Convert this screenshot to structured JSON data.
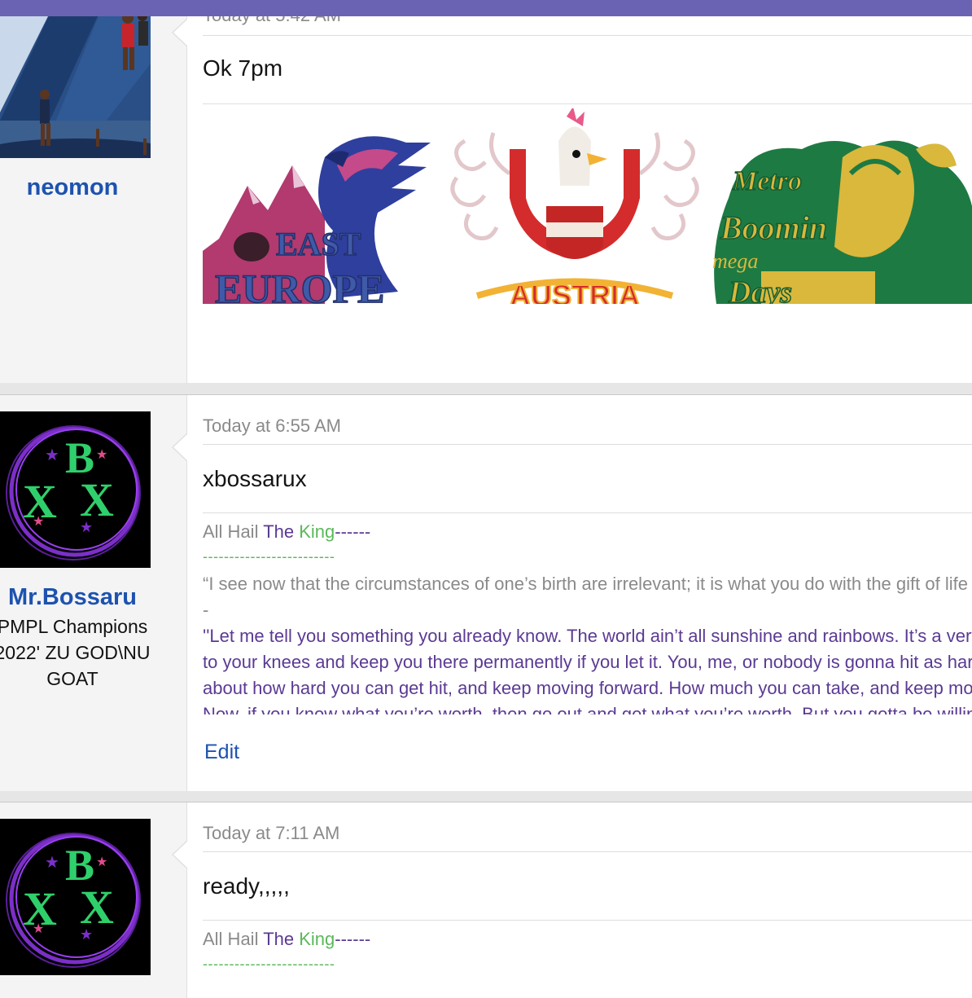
{
  "header": {
    "bar_color": "#6a63b4"
  },
  "posts": [
    {
      "username": "neomon",
      "timestamp": "Today at 5:42 AM",
      "message": "Ok 7pm",
      "stickers": [
        {
          "label_top": "EAST",
          "label_bottom": "EUROPE"
        },
        {
          "label": "AUSTRIA"
        },
        {
          "line1": "Metro",
          "line2": "Boomin",
          "line3": "mega",
          "line4": "Days"
        }
      ]
    },
    {
      "username": "Mr.Bossaru",
      "user_title_1": "PMPL Champions",
      "user_title_2": "2022' ZU GOD\\NU",
      "user_title_3": "GOAT",
      "timestamp": "Today at 6:55 AM",
      "message": "xbossarux",
      "signature": {
        "prefix": "All Hail ",
        "the": "The",
        "king": "King",
        "dashes_short": "------",
        "dashes_long": "-------------------------",
        "quote1": "“I see now that the circumstances of one’s birth are irrelevant; it is what you do with the gift of life that determines who you are.”",
        "quote_sep": "-",
        "quote2_l1": "''Let me tell you something you already know. The world ain’t all sunshine and rainbows. It’s a very mean and nasty place and it will beat you",
        "quote2_l2": "to your knees and keep you there permanently if you let it. You, me, or nobody is gonna hit as hard as life. But it ain’t how hard you hit; it’s",
        "quote2_l3": "about how hard you can get hit, and keep moving forward. How much you can take, and keep moving forward. That’s how winning is done.",
        "quote2_l4": "Now, if you know what you’re worth, then go out and get what you’re worth. But you gotta be willing to take the hit."
      },
      "edit_label": "Edit"
    },
    {
      "timestamp": "Today at 7:11 AM",
      "message": "ready,,,,,",
      "signature": {
        "prefix": "All Hail ",
        "the": "The",
        "king": "King",
        "dashes_short": "------",
        "dashes_long": "-------------------------"
      }
    }
  ],
  "avatar_logo": {
    "b": "B",
    "x_left": "X",
    "x_right": "X"
  }
}
